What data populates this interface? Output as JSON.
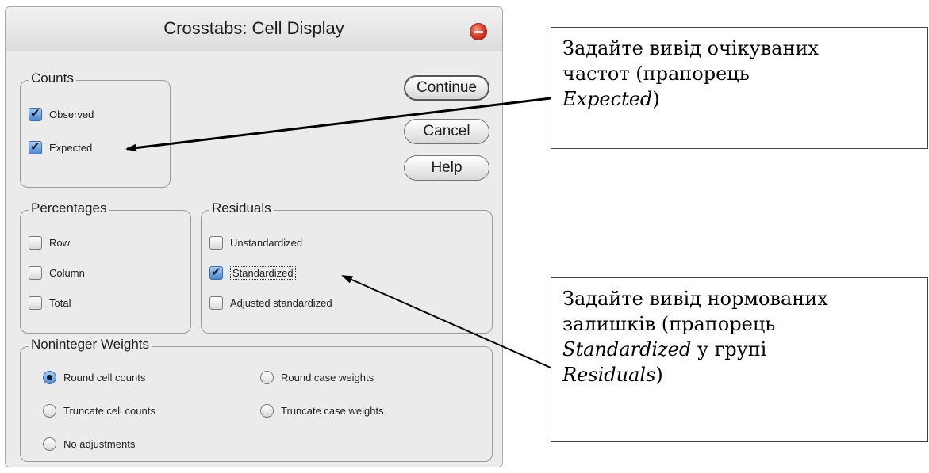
{
  "dialog": {
    "title": "Crosstabs: Cell Display",
    "buttons": {
      "continue": "Continue",
      "cancel": "Cancel",
      "help": "Help"
    },
    "counts": {
      "legend": "Counts",
      "observed": {
        "label": "Observed",
        "checked": true
      },
      "expected": {
        "label": "Expected",
        "checked": true
      }
    },
    "percentages": {
      "legend": "Percentages",
      "row": {
        "label": "Row",
        "checked": false
      },
      "column": {
        "label": "Column",
        "checked": false
      },
      "total": {
        "label": "Total",
        "checked": false
      }
    },
    "residuals": {
      "legend": "Residuals",
      "unstandardized": {
        "label": "Unstandardized",
        "checked": false
      },
      "standardized": {
        "label": "Standardized",
        "checked": true
      },
      "adjusted": {
        "label": "Adjusted standardized",
        "checked": false
      }
    },
    "weights": {
      "legend": "Noninteger Weights",
      "round_cell": {
        "label": "Round cell counts",
        "selected": true
      },
      "truncate_cell": {
        "label": "Truncate cell counts",
        "selected": false
      },
      "no_adjust": {
        "label": "No adjustments",
        "selected": false
      },
      "round_case": {
        "label": "Round case weights",
        "selected": false
      },
      "truncate_case": {
        "label": "Truncate case weights",
        "selected": false
      }
    }
  },
  "annotations": {
    "top": {
      "line1": "Задайте вивід очікуваних",
      "line2": "частот (прапорець",
      "line3_italic": "Expected",
      "line3_tail": ")"
    },
    "bottom": {
      "line1": "Задайте вивід нормованих",
      "line2": "залишків (прапорець",
      "line3_italic": "Standardized",
      "line3_tail": " у групі",
      "line4_italic": "Residuals",
      "line4_tail": ")"
    }
  },
  "colors": {
    "dialog_bg": "#ebebeb",
    "check_accent": "#4d86cc",
    "close_button": "#e0402a"
  }
}
